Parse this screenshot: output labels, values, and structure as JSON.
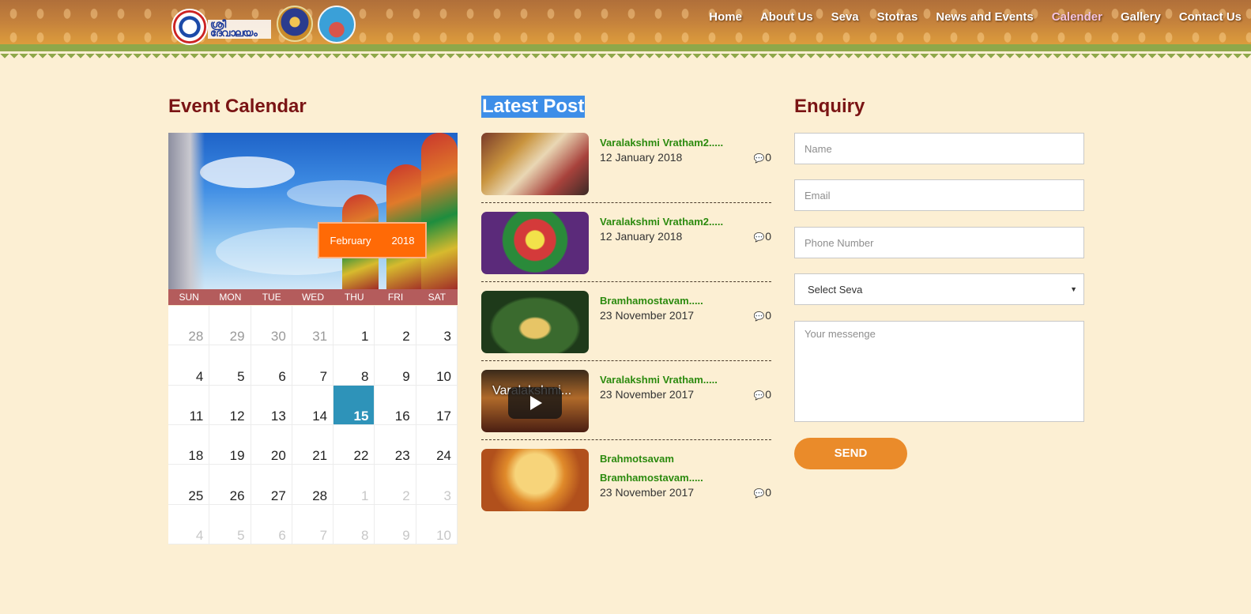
{
  "nav": {
    "items": [
      {
        "label": "Home"
      },
      {
        "label": "About Us"
      },
      {
        "label": "Seva"
      },
      {
        "label": "Stotras"
      },
      {
        "label": "News and Events"
      },
      {
        "label": "Calender",
        "active": true
      },
      {
        "label": "Gallery"
      },
      {
        "label": "Contact Us"
      }
    ],
    "active_color": "#f3c3e0"
  },
  "calendar": {
    "title": "Event Calendar",
    "month": "February",
    "year": "2018",
    "weekdays": [
      "SUN",
      "MON",
      "TUE",
      "WED",
      "THU",
      "FRI",
      "SAT"
    ],
    "weeks": [
      [
        {
          "d": "28",
          "s": "muted"
        },
        {
          "d": "29",
          "s": "muted"
        },
        {
          "d": "30",
          "s": "muted"
        },
        {
          "d": "31",
          "s": "muted"
        },
        {
          "d": "1"
        },
        {
          "d": "2"
        },
        {
          "d": "3"
        }
      ],
      [
        {
          "d": "4"
        },
        {
          "d": "5"
        },
        {
          "d": "6"
        },
        {
          "d": "7"
        },
        {
          "d": "8"
        },
        {
          "d": "9"
        },
        {
          "d": "10"
        }
      ],
      [
        {
          "d": "11"
        },
        {
          "d": "12"
        },
        {
          "d": "13"
        },
        {
          "d": "14"
        },
        {
          "d": "15",
          "s": "today"
        },
        {
          "d": "16"
        },
        {
          "d": "17"
        }
      ],
      [
        {
          "d": "18"
        },
        {
          "d": "19"
        },
        {
          "d": "20"
        },
        {
          "d": "21"
        },
        {
          "d": "22"
        },
        {
          "d": "23"
        },
        {
          "d": "24"
        }
      ],
      [
        {
          "d": "25"
        },
        {
          "d": "26"
        },
        {
          "d": "27"
        },
        {
          "d": "28"
        },
        {
          "d": "1",
          "s": "faded"
        },
        {
          "d": "2",
          "s": "faded"
        },
        {
          "d": "3",
          "s": "faded"
        }
      ],
      [
        {
          "d": "4",
          "s": "faded"
        },
        {
          "d": "5",
          "s": "faded"
        },
        {
          "d": "6",
          "s": "faded"
        },
        {
          "d": "7",
          "s": "faded"
        },
        {
          "d": "8",
          "s": "faded"
        },
        {
          "d": "9",
          "s": "faded"
        },
        {
          "d": "10",
          "s": "faded"
        }
      ]
    ],
    "today_color": "#2e93b9",
    "header_color": "#b45c5c",
    "month_box_color": "#ff6a06"
  },
  "latest_posts": {
    "title": "Latest Post",
    "posts": [
      {
        "title": "Varalakshmi Vratham2.....",
        "date": "12 January 2018",
        "comments": "0",
        "thumb": "ceremony"
      },
      {
        "title": "Varalakshmi Vratham2.....",
        "date": "12 January 2018",
        "comments": "0",
        "thumb": "deity"
      },
      {
        "title": "Bramhamostavam.....",
        "date": "23 November 2017",
        "comments": "0",
        "thumb": "idols"
      },
      {
        "title": "Varalakshmi Vratham.....",
        "date": "23 November 2017",
        "comments": "0",
        "thumb": "video",
        "overlay_title": "Varalakshmi..."
      },
      {
        "title": "Brahmotsavam",
        "title2": "Bramhamostavam.....",
        "date": "23 November 2017",
        "comments": "0",
        "thumb": "poster"
      }
    ],
    "title_color": "#2b8a0e"
  },
  "enquiry": {
    "title": "Enquiry",
    "name_placeholder": "Name",
    "email_placeholder": "Email",
    "phone_placeholder": "Phone Number",
    "seva_selected": "Select Seva",
    "message_placeholder": "Your messenge",
    "send_label": "SEND",
    "send_color": "#ea8b2a"
  },
  "heading_color": "#7a1414"
}
